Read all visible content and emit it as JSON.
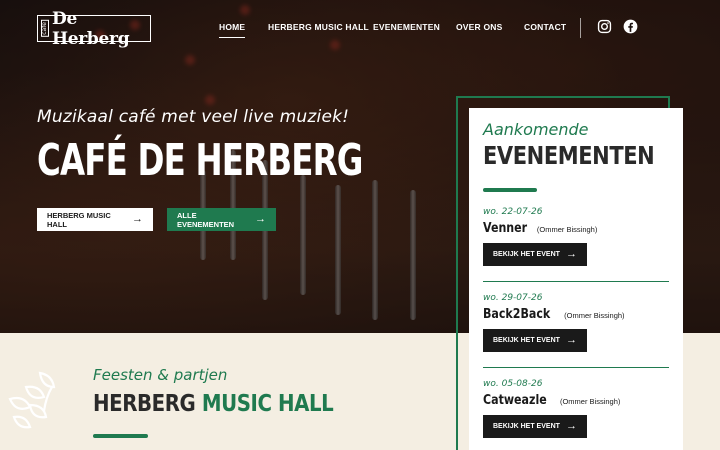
{
  "brand": {
    "logo_small": "café",
    "logo_text": "De Herberg"
  },
  "nav": {
    "items": [
      {
        "label": "HOME",
        "active": true
      },
      {
        "label": "HERBERG MUSIC HALL",
        "active": false
      },
      {
        "label": "EVENEMENTEN",
        "active": false
      },
      {
        "label": "OVER ONS",
        "active": false
      },
      {
        "label": "CONTACT",
        "active": false
      }
    ],
    "social": [
      "instagram-icon",
      "facebook-icon"
    ]
  },
  "hero": {
    "tagline": "Muzikaal café met veel live muziek!",
    "title": "CAFÉ DE HERBERG",
    "buttons": [
      {
        "label": "HERBERG MUSIC HALL",
        "icon": "arrow-right-icon"
      },
      {
        "label": "ALLE EVENEMENTEN",
        "icon": "arrow-right-icon"
      }
    ]
  },
  "music_hall": {
    "script": "Feesten & partjen",
    "title_dark": "HERBERG",
    "title_green": "MUSIC HALL"
  },
  "events_panel": {
    "script": "Aankomende",
    "title": "EVENEMENTEN",
    "events": [
      {
        "date": "wo. 22-07-26",
        "name": "Venner",
        "location": "(Ommer Bissingh)",
        "button": "BEKIJK HET EVENT"
      },
      {
        "date": "wo. 29-07-26",
        "name": "Back2Back",
        "location": "(Ommer Bissingh)",
        "button": "BEKIJK HET EVENT"
      },
      {
        "date": "wo. 05-08-26",
        "name": "Catweazle",
        "location": "(Ommer Bissingh)",
        "button": "BEKIJK HET EVENT"
      }
    ]
  },
  "colors": {
    "accent": "#1f7a4f",
    "dark": "#1a1a1a",
    "cream": "#f4eee2"
  }
}
